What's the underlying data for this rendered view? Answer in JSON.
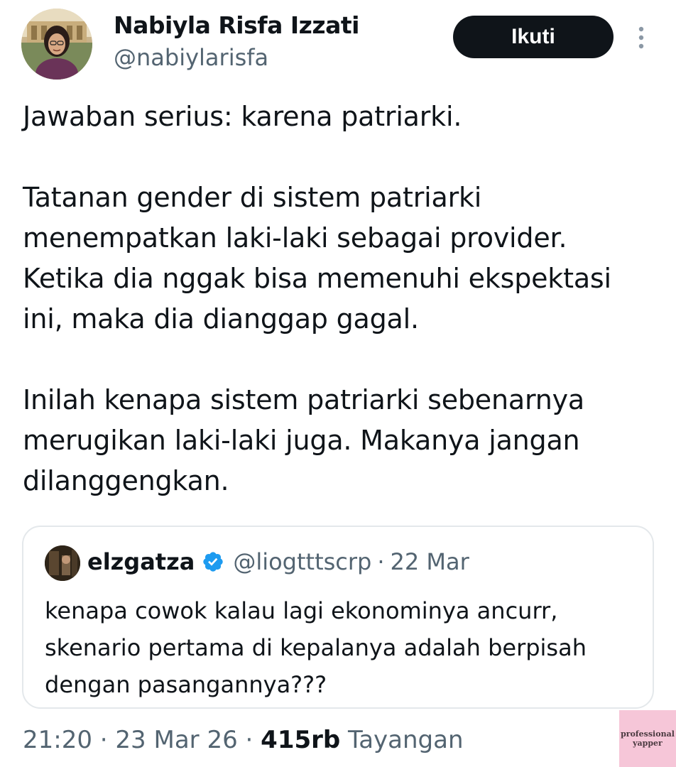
{
  "author": {
    "name": "Nabiyla Risfa Izzati",
    "handle": "@nabiylarisfa",
    "avatar_icon": "profile-photo"
  },
  "follow_button": {
    "label": "Ikuti"
  },
  "more_icon": "more-vertical-icon",
  "tweet": {
    "paragraphs": [
      "Jawaban serius: karena patriarki.",
      "Tatanan gender di sistem patriarki menempatkan laki-laki sebagai provider. Ketika dia nggak bisa memenuhi ekspektasi ini, maka dia dianggap gagal.",
      "Inilah kenapa sistem patriarki sebenarnya merugikan laki-laki juga. Makanya jangan dilanggengkan."
    ]
  },
  "quote": {
    "name": "elzgatza",
    "verified": true,
    "handle": "@liogtttscrp",
    "separator": "·",
    "date": "22 Mar",
    "text": "kenapa cowok kalau lagi ekonominya ancurr, skenario pertama di kepalanya adalah berpisah dengan pasangannya???"
  },
  "meta": {
    "time": "21:20",
    "separator": "·",
    "date": "23 Mar 26",
    "views_count": "415rb",
    "views_label": "Tayangan"
  },
  "watermark": {
    "line1": "professional",
    "line2": "yapper"
  },
  "colors": {
    "text_primary": "#0f1419",
    "text_secondary": "#536471",
    "verified_blue": "#1d9bf0",
    "border": "#e4e8eb"
  }
}
